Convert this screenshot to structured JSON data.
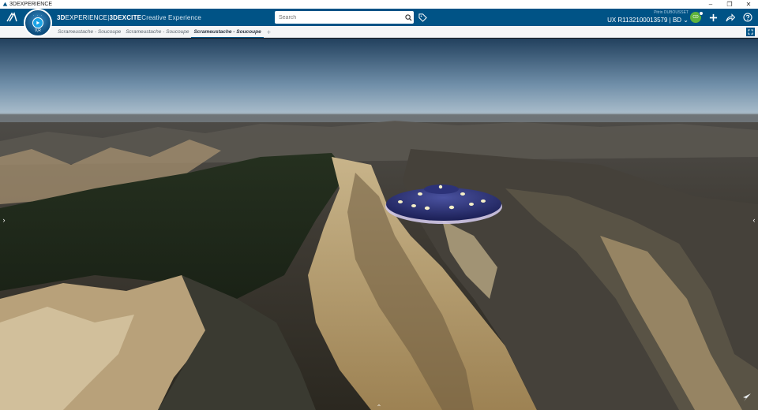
{
  "os_window": {
    "title": "3DEXPERIENCE"
  },
  "header": {
    "brand_bold": "3D",
    "brand_rest": "EXPERIENCE",
    "separator": " | ",
    "app_bold": "3DEXCITE",
    "app_rest": " Creative Experience",
    "search_placeholder": "Search",
    "user_name": "Pitrin DUBOUSSET",
    "workspace": "UX R1132100013579 | BD",
    "avatar_initials": "CD",
    "compass_label": "V,R"
  },
  "tabs": [
    {
      "label": "Scrameustache - Soucoupe",
      "active": false
    },
    {
      "label": "Scrameustache - Soucoupe",
      "active": false
    },
    {
      "label": "Scrameustache - Soucoupe",
      "active": true
    }
  ],
  "tab_add_label": "+",
  "icons": {
    "os": [
      "app-logo-icon",
      "minimize-icon",
      "restore-icon",
      "close-icon"
    ],
    "toolbar": [
      "ds-logo-icon",
      "search-icon",
      "tag-icon",
      "chevron-down-icon",
      "add-icon",
      "share-icon",
      "help-icon",
      "fullscreen-icon"
    ],
    "viewport": [
      "left-arrow-icon",
      "right-arrow-icon",
      "up-arrow-icon",
      "navigation-arrow-icon"
    ]
  },
  "colors": {
    "topbar": "#005386",
    "tab_active_underline": "#005386",
    "avatar": "#5fb33b",
    "ufo_body": "#2a2f6a",
    "ufo_lights": "#f6f0c8"
  }
}
